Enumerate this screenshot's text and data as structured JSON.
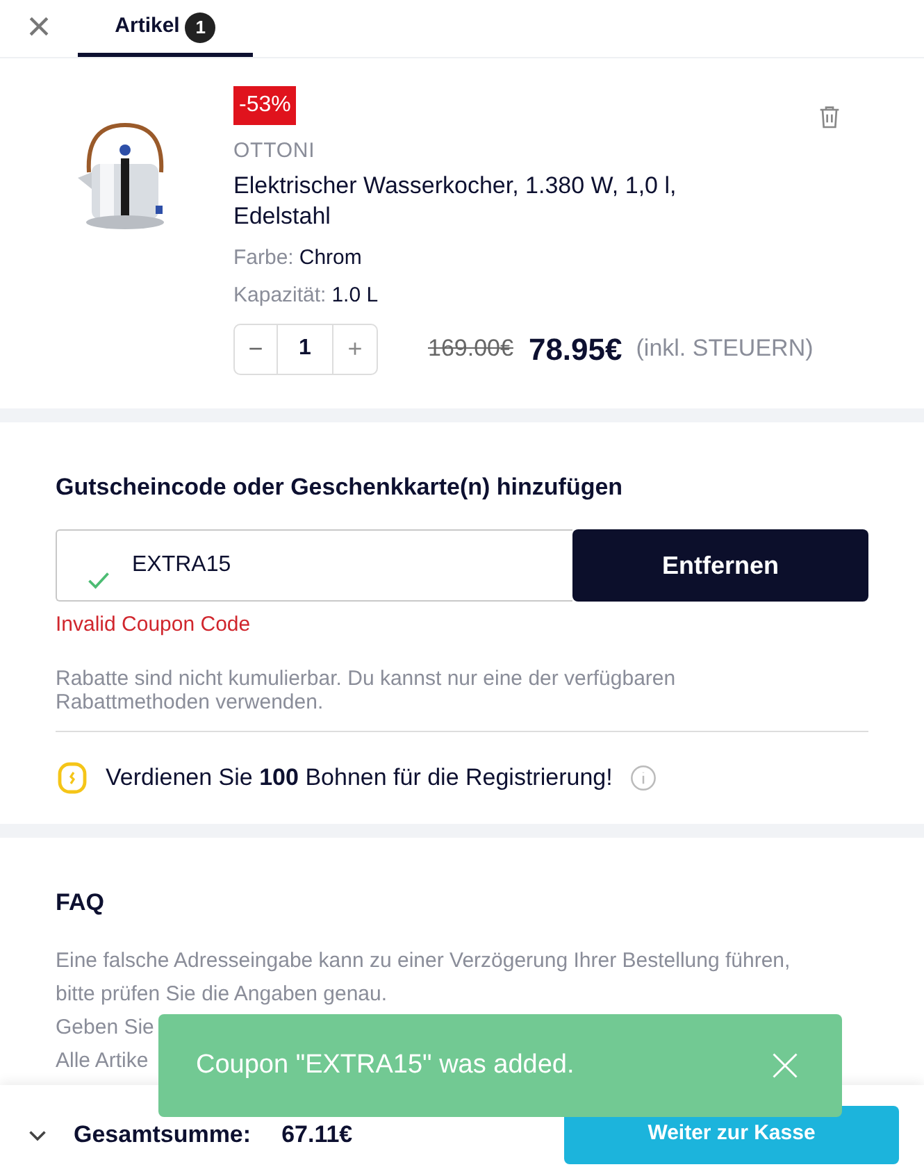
{
  "header": {
    "close": "×",
    "tabs": [
      {
        "label": "Artikel",
        "count": "1",
        "selected": true
      }
    ]
  },
  "cart_item": {
    "kind": "picture",
    "discount": "-53%",
    "brand": "OTTONI",
    "title": "Elektrischer Wasserkocher, 1.380 W, 1,0 l, Edelstahl",
    "attributes": [
      {
        "label": "Farbe:",
        "value": "Chrom"
      },
      {
        "label": "Kapazität:",
        "value": "1.0 L"
      }
    ],
    "quantity": "1",
    "decrement": "−",
    "increment": "+",
    "old_price": "169.00€",
    "price": "78.95€",
    "tax_note": "(inkl. STEUERN)"
  },
  "coupon": {
    "heading": "Gutscheincode oder Geschenkkarte(n) hinzufügen",
    "value": "EXTRA15",
    "valid": true,
    "button": "Entfernen",
    "error": "Invalid Coupon Code",
    "note": "Rabatte sind nicht kumulierbar. Du kannst nur eine der verfügbaren Rabattmethoden verwenden.",
    "reward": "Verdienen Sie **100** Bohnen für die Registrierung!"
  },
  "faq": {
    "heading": "FAQ",
    "lines": [
      "Eine falsche Adresseingabe kann zu einer Verzögerung Ihrer Bestellung führen, bitte prüfen Sie die Angaben genau.",
      "Geben Sie",
      "Alle Artike"
    ]
  },
  "toast": {
    "message": "Coupon \"EXTRA15\" was added."
  },
  "footer": {
    "total_label": "Gesamtsumme:",
    "total": "67.11€",
    "checkout": "Weiter zur Kasse"
  }
}
